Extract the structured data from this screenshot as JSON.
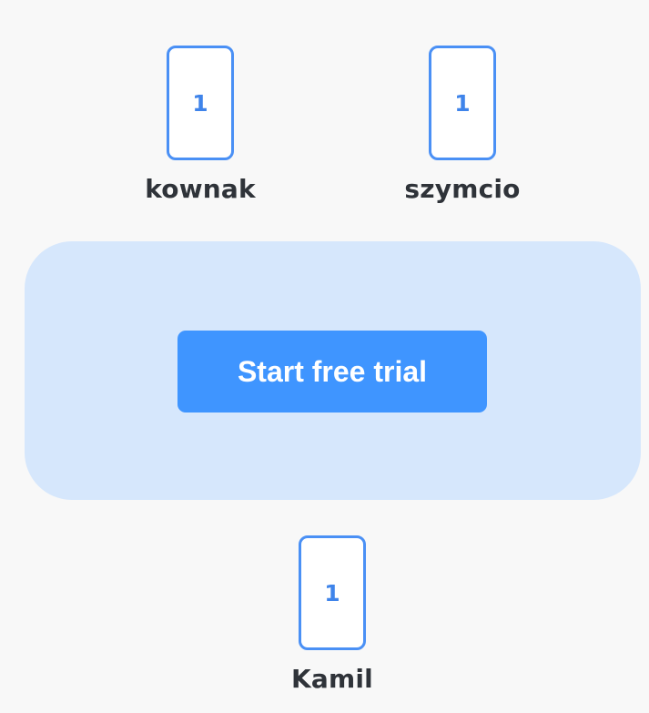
{
  "players": [
    {
      "name": "kownak",
      "card_value": "1"
    },
    {
      "name": "szymcio",
      "card_value": "1"
    },
    {
      "name": "Kamil",
      "card_value": "1"
    }
  ],
  "table": {
    "button_label": "Start free trial"
  },
  "colors": {
    "background": "#f8f8f8",
    "card_border": "#4a90f5",
    "card_text": "#3f84ea",
    "table_background": "#d6e7fc",
    "button_background": "#3f95ff",
    "button_text": "#ffffff",
    "name_text": "#2f3339"
  }
}
